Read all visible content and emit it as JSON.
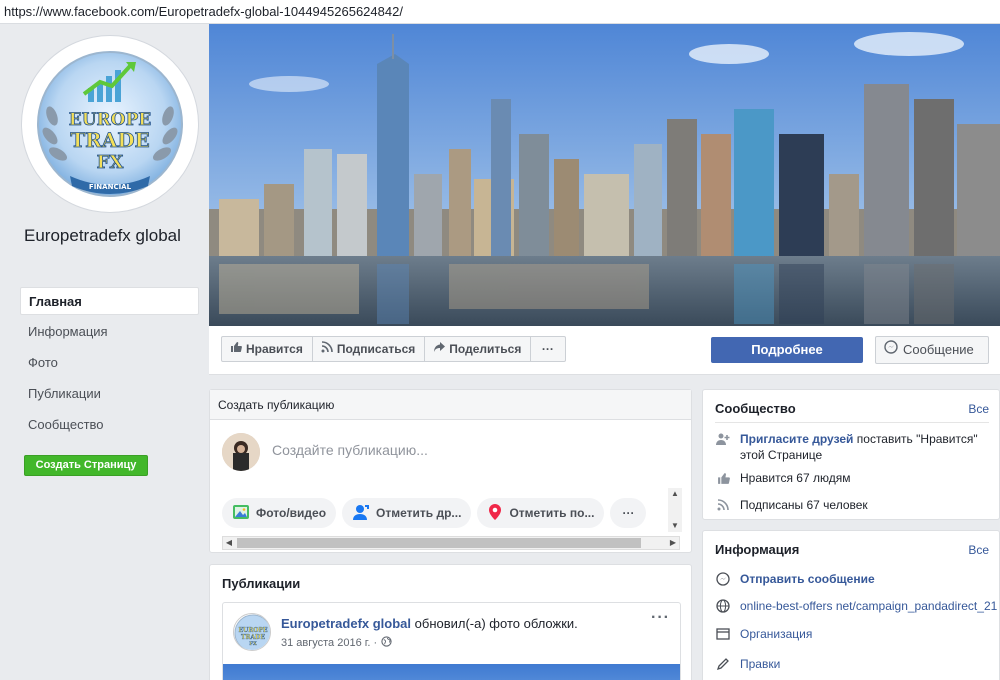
{
  "browser": {
    "url": "https://www.facebook.com/Europetradefx-global-1044945265624842/"
  },
  "page": {
    "name": "Europetradefx global",
    "logo_text": [
      "EUROPE",
      "TRADE",
      "FX",
      "FINANCIAL"
    ]
  },
  "sidebar": {
    "items": [
      {
        "label": "Главная",
        "active": true
      },
      {
        "label": "Информация"
      },
      {
        "label": "Фото"
      },
      {
        "label": "Публикации"
      },
      {
        "label": "Сообщество"
      }
    ],
    "create_page": "Создать Страницу"
  },
  "actionbar": {
    "like": "Нравится",
    "subscribe": "Подписаться",
    "share": "Поделиться",
    "more": "···",
    "learn_more": "Подробнее",
    "message": "Сообщение"
  },
  "composer": {
    "title": "Создать публикацию",
    "placeholder": "Создайте публикацию...",
    "actions": [
      {
        "label": "Фото/видео",
        "icon": "photo-icon"
      },
      {
        "label": "Отметить др...",
        "icon": "tag-friends-icon"
      },
      {
        "label": "Отметить по...",
        "icon": "location-pin-icon"
      }
    ],
    "more": "···"
  },
  "publications": {
    "title": "Публикации",
    "post": {
      "author": "Europetradefx global",
      "action": " обновил(-а) фото обложки.",
      "date": "31 августа 2016 г. ·",
      "more": "···"
    }
  },
  "community": {
    "title": "Сообщество",
    "all": "Все",
    "rows": [
      {
        "icon": "invite-friends-icon",
        "strong": "Пригласите друзей",
        "text": " поставить \"Нравится\" этой Странице"
      },
      {
        "icon": "thumbs-up-icon",
        "text": "Нравится 67 людям"
      },
      {
        "icon": "rss-icon",
        "text": "Подписаны 67 человек"
      }
    ]
  },
  "info": {
    "title": "Информация",
    "all": "Все",
    "rows": [
      {
        "icon": "messenger-icon",
        "text": "Отправить сообщение"
      },
      {
        "icon": "globe-icon",
        "text": "online-best-offers net/campaign_pandadirect_21"
      },
      {
        "icon": "category-icon",
        "text": "Организация"
      },
      {
        "icon": "pencil-icon",
        "text": "Правки"
      }
    ]
  },
  "colors": {
    "fb_blue": "#4267b2",
    "link": "#365899",
    "green": "#42b72a",
    "bg": "#e9ebee"
  }
}
